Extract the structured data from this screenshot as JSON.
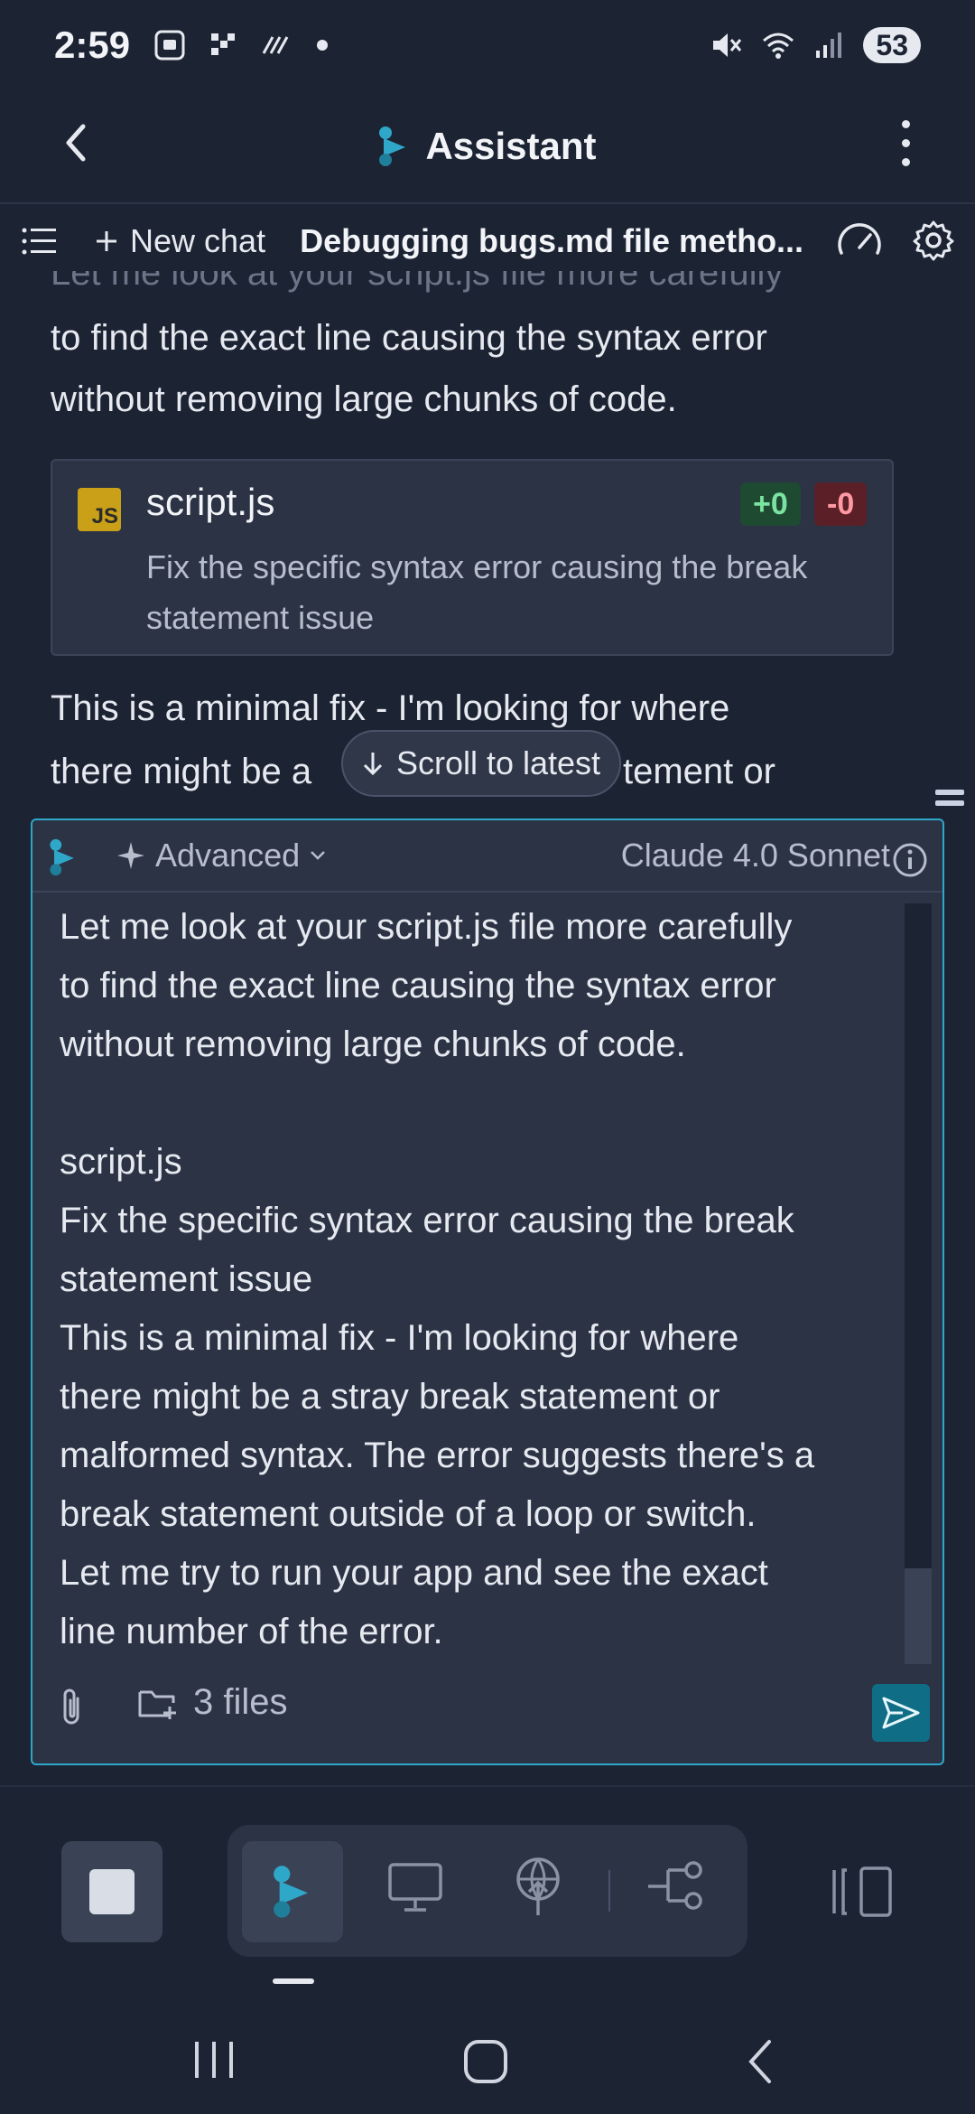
{
  "status_bar": {
    "time": "2:59",
    "battery": "53"
  },
  "app_header": {
    "title": "Assistant",
    "back_icon": "back-arrow-icon",
    "more_icon": "more-vertical-icon"
  },
  "toolbar": {
    "new_chat_label": "New chat",
    "chat_title": "Debugging bugs.md file metho...",
    "speed_icon": "speedometer-icon",
    "settings_icon": "gear-icon"
  },
  "conversation": {
    "faded_line": "Let me look at your script.js file more carefully",
    "intro_line1": "to find the exact line causing the syntax error",
    "intro_line2": "without removing large chunks of code.",
    "file_card": {
      "badge": "JS",
      "name": "script.js",
      "description": "Fix the specific syntax error causing the break statement issue",
      "added": "+0",
      "removed": "-0"
    },
    "partial_line1": "This is a minimal fix - I'm looking for where",
    "partial_line2_start": "there might be a",
    "partial_line2_end": "tement or",
    "scroll_to_latest": "Scroll to latest"
  },
  "composer": {
    "mode_label": "Advanced",
    "model_label": "Claude 4.0 Sonnet",
    "text": "Let me look at your script.js file more carefully\nto find the exact line causing the syntax error\nwithout removing large chunks of code.\n\nscript.js\nFix the specific syntax error causing the break\nstatement issue\nThis is a minimal fix - I'm looking for where\nthere might be a stray break statement or\nmalformed syntax. The error suggests there's a\nbreak statement outside of a loop or switch.\nLet me try to run your app and see the exact\nline number of the error.",
    "files_label": "3 files"
  },
  "dock": {
    "items": [
      "stop-icon",
      "assistant-icon",
      "monitor-icon",
      "deploy-icon",
      "workflow-icon",
      "panel-icon"
    ]
  },
  "colors": {
    "background": "#1c2333",
    "surface": "#2b3345",
    "accent": "#2fa7c9",
    "send": "#0f6e86"
  }
}
